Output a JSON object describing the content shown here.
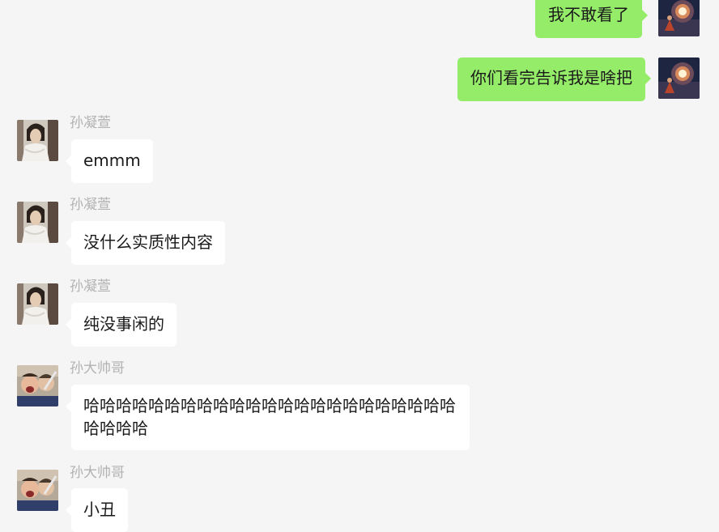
{
  "colors": {
    "background": "#f5f5f5",
    "outgoing_bubble": "#95ec69",
    "incoming_bubble": "#ffffff",
    "sender_name": "#b2b2b2",
    "text": "#1a1a1a"
  },
  "messages": [
    {
      "direction": "outgoing",
      "avatar": "self-avatar",
      "text": "我不敢看了"
    },
    {
      "direction": "outgoing",
      "avatar": "self-avatar",
      "text": "你们看完告诉我是啥把"
    },
    {
      "direction": "incoming",
      "sender": "孙凝萱",
      "avatar": "sun-ningxuan-avatar",
      "text": "emmm"
    },
    {
      "direction": "incoming",
      "sender": "孙凝萱",
      "avatar": "sun-ningxuan-avatar",
      "text": "没什么实质性内容"
    },
    {
      "direction": "incoming",
      "sender": "孙凝萱",
      "avatar": "sun-ningxuan-avatar",
      "text": "纯没事闲的"
    },
    {
      "direction": "incoming",
      "sender": "孙大帅哥",
      "avatar": "sun-dashuaige-avatar",
      "text": "哈哈哈哈哈哈哈哈哈哈哈哈哈哈哈哈哈哈哈哈哈哈哈哈哈哈哈"
    },
    {
      "direction": "incoming",
      "sender": "孙大帅哥",
      "avatar": "sun-dashuaige-avatar",
      "text": "小丑"
    }
  ]
}
